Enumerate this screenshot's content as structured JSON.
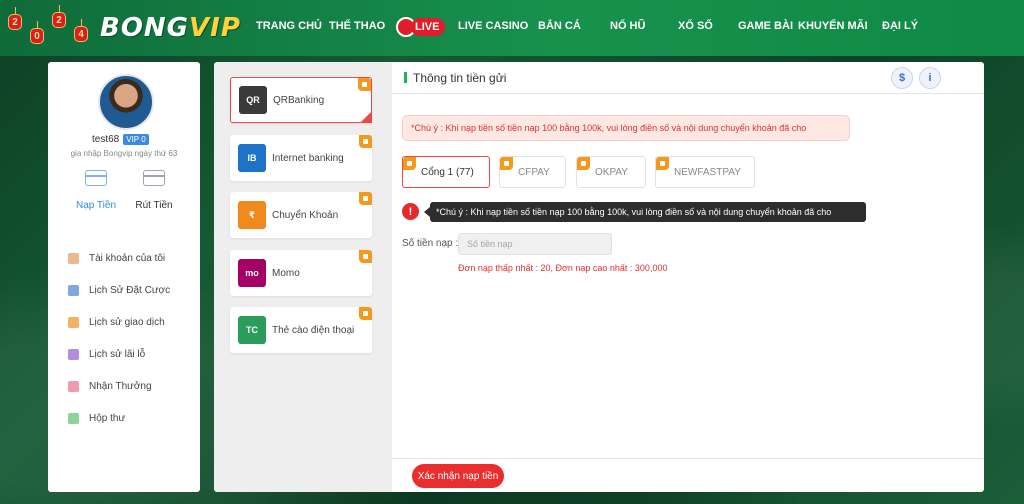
{
  "header": {
    "logo_text": "BONG",
    "logo_accent": "VIP",
    "lantern_digits": [
      "2",
      "0",
      "2",
      "4"
    ],
    "nav": [
      {
        "label": "TRANG CHỦ"
      },
      {
        "label": "THỂ THAO"
      },
      {
        "label": "LIVE"
      },
      {
        "label": "LIVE CASINO"
      },
      {
        "label": "BẮN CÁ"
      },
      {
        "label": "NỔ HŨ"
      },
      {
        "label": "XỔ SỐ"
      },
      {
        "label": "GAME BÀI"
      },
      {
        "label": "KHUYẾN MÃI"
      },
      {
        "label": "ĐẠI LÝ"
      }
    ]
  },
  "profile": {
    "username": "test68",
    "vip": "VIP 0",
    "join_text": "gia nhập Bongvip ngày thứ 63",
    "actions": [
      {
        "label": "Nạp Tiền",
        "icon": "card-icon",
        "active": true
      },
      {
        "label": "Rút Tiền",
        "icon": "wallet-icon",
        "active": false
      }
    ],
    "menu": [
      {
        "label": "Tài khoản của tôi",
        "icon": "account-icon",
        "color": "#e9b88f"
      },
      {
        "label": "Lịch Sử Đặt Cược",
        "icon": "bet-history-icon",
        "color": "#7fa7e0"
      },
      {
        "label": "Lịch sử giao dịch",
        "icon": "transaction-icon",
        "color": "#f2b266"
      },
      {
        "label": "Lịch sử lãi lỗ",
        "icon": "profit-loss-icon",
        "color": "#b18fe0"
      },
      {
        "label": "Nhận Thưởng",
        "icon": "reward-icon",
        "color": "#f09ab0"
      },
      {
        "label": "Hộp thư",
        "icon": "mail-icon",
        "color": "#8fd39b"
      }
    ]
  },
  "methods": [
    {
      "label": "QRBanking",
      "icon": "qr-icon",
      "color": "#3a3a3a",
      "glyph": "QR",
      "selected": true
    },
    {
      "label": "Internet banking",
      "icon": "internet-banking-icon",
      "color": "#1e73c8",
      "glyph": "IB",
      "selected": false
    },
    {
      "label": "Chuyển Khoản",
      "icon": "transfer-icon",
      "color": "#f08a1c",
      "glyph": "₹",
      "selected": false
    },
    {
      "label": "Momo",
      "icon": "momo-icon",
      "color": "#a50064",
      "glyph": "mo",
      "selected": false
    },
    {
      "label": "Thẻ cào điện thoại",
      "icon": "phone-card-icon",
      "color": "#2a9d5a",
      "glyph": "TC",
      "selected": false
    }
  ],
  "main": {
    "title": "Thông tin tiền gửi",
    "notice": "*Chú ý : Khi nạp tiền số tiền nạp 100 bằng 100k, vui lòng điền số và nội dung chuyển khoản đã cho",
    "gates": [
      {
        "label": "Cổng 1 (77)",
        "selected": true
      },
      {
        "label": "CFPAY",
        "selected": false
      },
      {
        "label": "OKPAY",
        "selected": false
      },
      {
        "label": "NEWFASTPAY",
        "selected": false
      }
    ],
    "warn_glyph": "!",
    "tooltip": "*Chú ý : Khi nạp tiền số tiền nạp 100 bằng 100k, vui lòng điền số và nội dung chuyển khoản đã cho",
    "amount_label": "Số tiền nạp :",
    "amount_placeholder": "Số tiền nạp",
    "limits": "Đơn nạp thấp nhất : 20,  Đơn nạp cao nhất : 300,000",
    "submit": "Xác nhận nạp tiền"
  }
}
